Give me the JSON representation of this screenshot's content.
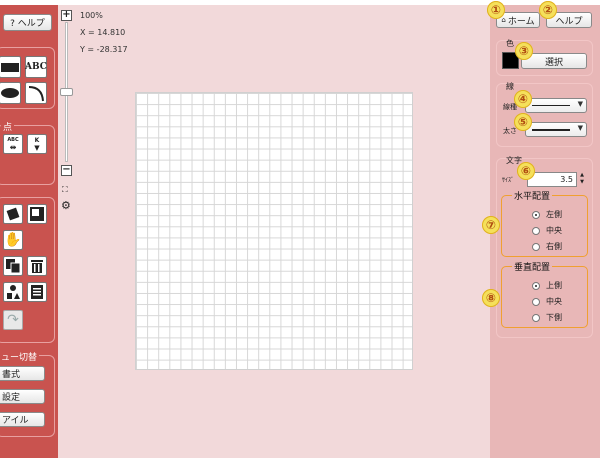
{
  "left": {
    "help_label": "? ヘルプ",
    "text_tool_label": "ABC",
    "section2_label": "点",
    "split_icon_text": "ABC",
    "k_icon_text": "K",
    "menu_switch_label": "ュー切替",
    "menu_buttons": [
      "書式",
      "設定",
      "アイル"
    ]
  },
  "canvas": {
    "zoom": "100%",
    "x_readout": "X = 14.810",
    "y_readout": "Y = -28.317"
  },
  "right": {
    "home_label": "ホーム",
    "help_label": "ヘルプ",
    "color_group": "色",
    "color_swatch": "#000000",
    "select_button": "選択",
    "line_group": "線",
    "line_type_label": "線種",
    "line_width_label": "太さ",
    "text_group": "文字",
    "size_label": "ｻｲｽﾞ",
    "size_value": "3.5",
    "horizontal": {
      "title": "水平配置",
      "options": [
        "左側",
        "中央",
        "右側"
      ],
      "selected": 0
    },
    "vertical": {
      "title": "垂直配置",
      "options": [
        "上側",
        "中央",
        "下側"
      ],
      "selected": 0
    }
  },
  "badges": [
    "①",
    "②",
    "③",
    "④",
    "⑤",
    "⑥",
    "⑦",
    "⑧"
  ],
  "colors": {
    "left_panel": "#c9534f",
    "canvas_bg": "#f2d9da",
    "right_panel": "#e8b7b7",
    "badge": "#f5e05a",
    "group_border": "#f0a030"
  }
}
